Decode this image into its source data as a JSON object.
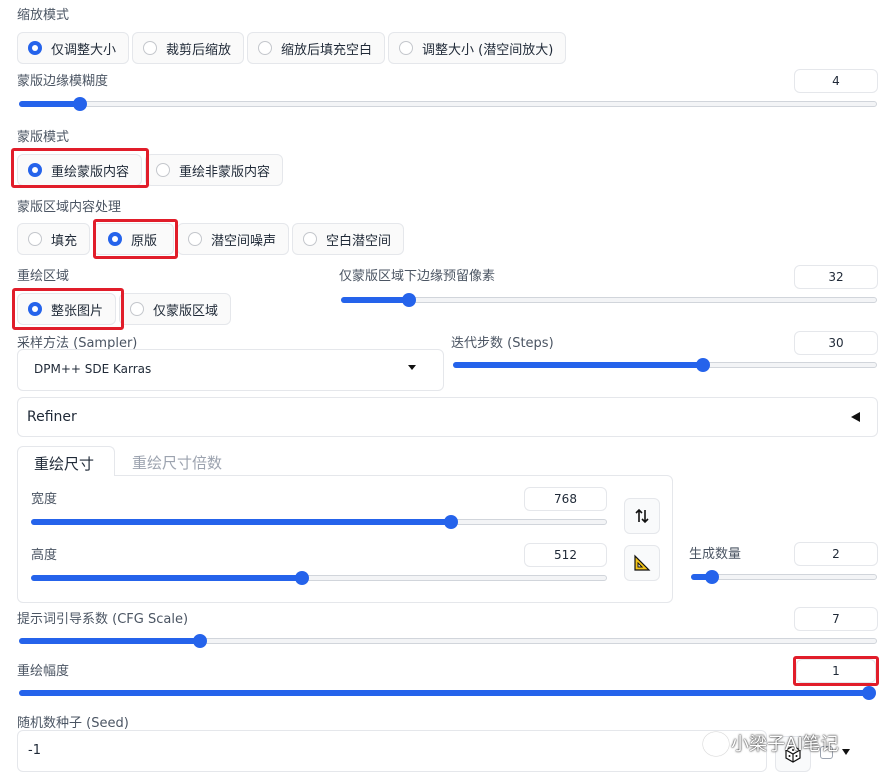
{
  "resize_mode": {
    "label": "缩放模式",
    "options": [
      "仅调整大小",
      "裁剪后缩放",
      "缩放后填充空白",
      "调整大小 (潜空间放大)"
    ],
    "selected": 0
  },
  "mask_blur": {
    "label": "蒙版边缘模糊度",
    "value": "4",
    "fraction": 0.07
  },
  "mask_mode": {
    "label": "蒙版模式",
    "options": [
      "重绘蒙版内容",
      "重绘非蒙版内容"
    ],
    "selected": 0
  },
  "masked_content": {
    "label": "蒙版区域内容处理",
    "options": [
      "填充",
      "原版",
      "潜空间噪声",
      "空白潜空间"
    ],
    "selected": 1
  },
  "inpaint_area": {
    "label": "重绘区域",
    "options": [
      "整张图片",
      "仅蒙版区域"
    ],
    "selected": 0
  },
  "only_masked_padding": {
    "label": "仅蒙版区域下边缘预留像素",
    "value": "32",
    "fraction": 0.125
  },
  "sampler": {
    "label": "采样方法 (Sampler)",
    "value": "DPM++ SDE Karras"
  },
  "steps": {
    "label": "迭代步数 (Steps)",
    "value": "30",
    "fraction": 0.59
  },
  "refiner": {
    "label": "Refiner"
  },
  "size_tabs": {
    "tabs": [
      "重绘尺寸",
      "重绘尺寸倍数"
    ],
    "active": 0
  },
  "width": {
    "label": "宽度",
    "value": "768",
    "fraction": 0.73
  },
  "height": {
    "label": "高度",
    "value": "512",
    "fraction": 0.47
  },
  "batch_count": {
    "label": "生成数量",
    "value": "2",
    "fraction": 0.11
  },
  "cfg_scale": {
    "label": "提示词引导系数 (CFG Scale)",
    "value": "7",
    "fraction": 0.21
  },
  "denoising": {
    "label": "重绘幅度",
    "value": "1",
    "fraction": 1.0
  },
  "seed": {
    "label": "随机数种子 (Seed)",
    "value": "-1"
  },
  "watermark": {
    "text": "小梁子AI笔记"
  },
  "colors": {
    "accent": "#2563eb",
    "highlight": "#e11d2a"
  }
}
